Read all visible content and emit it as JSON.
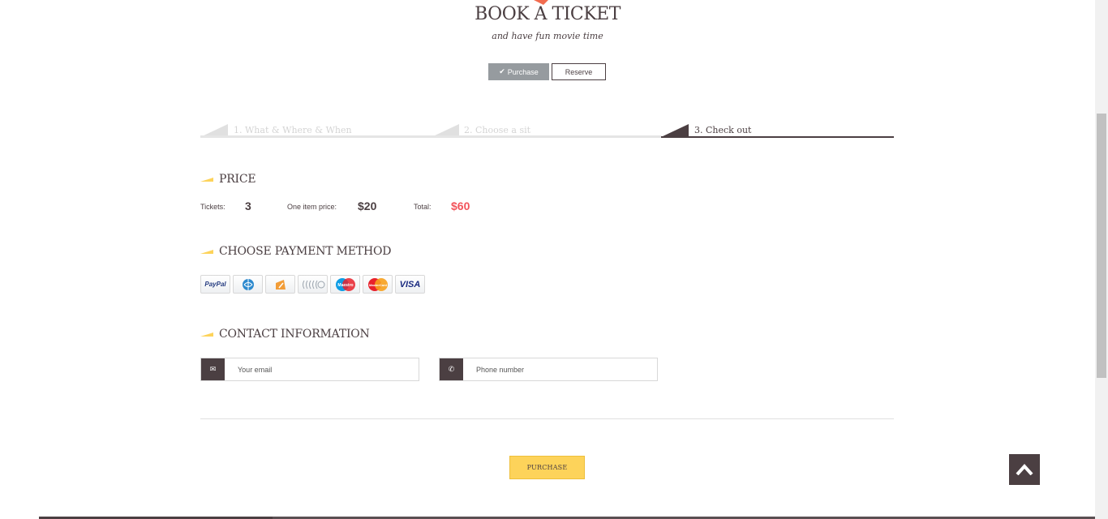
{
  "header": {
    "title": "BOOK A TICKET",
    "subtitle": "and have fun movie time"
  },
  "mode_toggle": {
    "purchase_label": "Purchase",
    "reserve_label": "Reserve",
    "selected": "Purchase"
  },
  "steps": [
    {
      "label": "1. What & Where & When",
      "active": false
    },
    {
      "label": "2. Choose a sit",
      "active": false
    },
    {
      "label": "3. Check out",
      "active": true
    }
  ],
  "price": {
    "heading": "PRICE",
    "tickets_label": "Tickets:",
    "tickets_value": "3",
    "item_price_label": "One item price:",
    "item_price_value": "$20",
    "total_label": "Total:",
    "total_value": "$60"
  },
  "payment": {
    "heading": "CHOOSE PAYMENT METHOD",
    "methods": [
      "paypal-icon",
      "webmoney-icon",
      "yandex-money-icon",
      "contactless-icon",
      "maestro-icon",
      "mastercard-icon",
      "visa-icon"
    ],
    "paypal_text": "PayPal",
    "visa_text": "VISA",
    "maestro_text": "Maestro",
    "mastercard_text": "MasterCard"
  },
  "contact": {
    "heading": "CONTACT INFORMATION",
    "email_placeholder": "Your email",
    "phone_placeholder": "Phone number"
  },
  "purchase_button": "PURCHASE",
  "colors": {
    "primary": "#4b3f42",
    "accent_yellow": "#fdd35a",
    "total_red": "#f2545b",
    "toggle_gray": "#969b9f"
  }
}
